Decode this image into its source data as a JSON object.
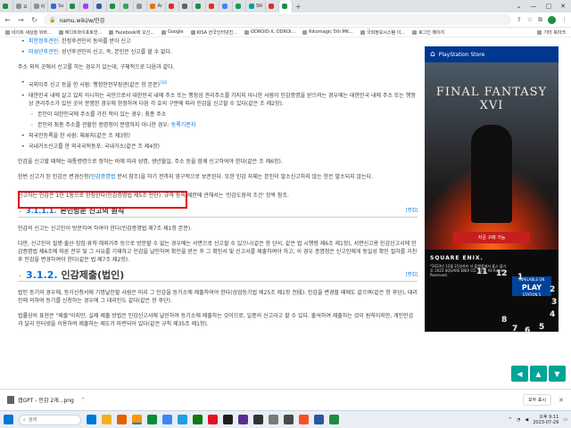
{
  "browser": {
    "tabs": [
      {
        "label": "",
        "color": "#1e8e3e"
      },
      {
        "label": "요",
        "color": "#8a8f98"
      },
      {
        "label": "하",
        "color": "#8a8f98"
      },
      {
        "label": "So",
        "color": "#3367d6"
      },
      {
        "label": "",
        "color": "#1e8e3e"
      },
      {
        "label": "",
        "color": "#a142f4"
      },
      {
        "label": "",
        "color": "#3b5998"
      },
      {
        "label": "",
        "color": "#1e8e3e"
      },
      {
        "label": "",
        "color": "#34a853"
      },
      {
        "label": "",
        "color": "#8a8f98"
      },
      {
        "label": "Ar",
        "color": "#e37400"
      },
      {
        "label": "",
        "color": "#d93025"
      },
      {
        "label": "",
        "color": "#5f6368"
      },
      {
        "label": "",
        "color": "#1e8e3e"
      },
      {
        "label": "",
        "color": "#d93025"
      },
      {
        "label": "",
        "color": "#4285f4"
      },
      {
        "label": "",
        "color": "#0f9d58"
      },
      {
        "label": "SN",
        "color": "#00a495"
      },
      {
        "label": "",
        "color": "#d93025"
      },
      {
        "label": "",
        "color": "#1e8e3e"
      }
    ],
    "window_controls": [
      "⌄",
      "—",
      "□",
      "✕"
    ],
    "url": "namu.wiki/w/인감",
    "bookmarks": [
      "네이트 세상을 뒤바...",
      "에디트와이포토한...",
      "Facebook에 오신...",
      "Google",
      "KISA 한국인터넷진...",
      "ODROID-X, ODROI...",
      "Rikomagic 5th MK...",
      "국회정보시스템 이...",
      "로그인 페이지"
    ],
    "other_bookmarks": "기타 북마크"
  },
  "article": {
    "top_items": [
      {
        "link": "피한정후견인",
        "text": ": 한정후견인의 동의를 받아 신고"
      },
      {
        "link": "미성년후견인",
        "text": ": 성년후견인의 신고, 즉, 본인은 신고를 할 수 없다."
      }
    ],
    "p_address": "주소 외의 곳에서 신고를 하는 경우가 있는데, 구체적으로 다음과 같다.",
    "list2": [
      {
        "text": "국외이주 신고 등을 한 사람: 행정안전부장관(같은 항 본문)",
        "sup": "[10]",
        "sub": false
      },
      {
        "text": "대한민국 내에 살고 있지 아니하는 국민으로서 대한민국 내에 주소 또는 행정상 관리주소를 가지지 아니한 사람이 인감증명을 받으려는 경우에는 대한민국 내에 주소 또는 행정상 관리주소가 있던 곳이 분명한 경우에 한정하여 다음 각 호의 구분에 따라 인감을 신고할 수 있다(같은 조 제2항).",
        "sup": "",
        "sub": false
      },
      {
        "text": "본인이 대한민국에 주소를 가진 적이 있는 경우: 최종 주소",
        "sub": true
      },
      {
        "text": "본인의 최종 주소를 관할한 증명청이 분명하지 아니한 경우: ",
        "link": "등록기준지",
        "sub": true
      },
      {
        "text": "외국인등록을 한 사람: 체류지(같은 조 제3항)",
        "sub": false
      },
      {
        "text": "국내거소신고를 한 외국국적동포: 국내거소(같은 조 제4항)",
        "sub": false
      }
    ],
    "p_multiple": "인감을 신고할 때에는 대통령령으로 정하는 바에 따라 성명, 생년월일, 주소 등을 함께 신고하여야 한다(같은 조 제6항).",
    "p_change_a": "한번 신고가 된 인감은 변경신청(",
    "p_change_link": "인감증명법",
    "p_change_b": " 문서 참조)을 하기 전까지 영구적으로 보존된다. 또한 인감 자체는 본인이 말소신고하지 않는 한은 말소되지 않는다.",
    "p_limit_boxed": "신고하는 인감은 1인 1통으로 한정한다(인감증명법 제5조 전단).",
    "p_limit_rest": " 규격 등의 제한에 관해서는 '인감도장의 조건' 항목 참조.",
    "sec311": {
      "num": "3.1.1.1.",
      "title": "본인방문 신고의 원칙",
      "edit": "[편집]"
    },
    "p311a": "인감의 신고는 신고인이 방문하여 하여야 한다(인감증명법 제7조 제1항 본문).",
    "p311b": "다만, 신고인이 질병·출산·징집·휴학·해외거주 등으로 방문할 수 없는 경우에는 서면으로 신고할 수 있으나(같은 항 단서, 같은 법 시행령 제6조 제1항), 서면신고용 인감신고서에 인감증명법 제6조에 따른 전부 및 그 사유를 기재하고 인감을 날인하여 확인을 받은 후 그 확인서 및 신고서를 제출하여야 하고, 이 경우 증명청은 신고인에게 동일성 확인 절차를 거친 후 인감을 변경하여야 한다(같은 법 제7조 제2항).",
    "sec312": {
      "num": "3.1.2.",
      "title": "인감제출(법인)",
      "edit": "[편집]"
    },
    "p312a": "법인 등기의 경우에, 등기신청서에 기명날인할 사람은 미리 그 인감을 등기소에 제출하여야 한다(상업등기법 제25조 제1항 전段). 인감을 변경할 때에도 같으며(같은 항 후단), 대리인에 의하여 등기를 신청하는 경우에 그 대리인도 같다(같은 항 후단).",
    "p312b": "법률상의 표현은 \"제출\"이지만, 실제 제출 방법은 인감신고서에 날인하여 등기소에 제출하는 것이므로, 일종의 신고라고 할 수 있다. 출석하여 제출하는 것이 원칙이지만, 개인인감과 달리 인터넷을 이용하여 제출하는 제도가 마련되어 있다(같은 규칙 제35조 제1항)."
  },
  "ad": {
    "store_label": "PlayStation Store",
    "game_title": "FINAL FANTASY XVI",
    "cta": "지금 구매 가능",
    "publisher": "SQUARE ENIX.",
    "fine_print": "*2023년 12월 31일까지 타 플랫폼에서 출시 불가.\n© 2023 SQUARE ENIX CO., LTD. All Rights Reserved.",
    "play_small": "AVAILABLE ON",
    "play_label": "PLAY",
    "play_sub": "STATION 5",
    "overlay_numbers": [
      "11",
      "12",
      "1",
      "2",
      "3",
      "4",
      "5",
      "6",
      "7",
      "8"
    ]
  },
  "floating": {
    "home": "◀",
    "up": "▲",
    "down": "▼"
  },
  "download_bar": {
    "file": "캡GPT - 인감 2개...png",
    "show_all": "모두 표시",
    "close": "✕"
  },
  "taskbar": {
    "search_placeholder": "검색",
    "time": "오후 9:11",
    "date": "2023-07-29",
    "apps": [
      "#0078d4",
      "#f2b01e",
      "#e66000",
      "#ff9500",
      "#0b8e36",
      "#4285f4",
      "#1ba1e2",
      "#107c10",
      "#e81123",
      "#1f1f1f",
      "#5c2d91",
      "#333333",
      "#7a7a7a",
      "#4a4a4a",
      "#f35325",
      "#2b579a",
      "#1e8e3e"
    ]
  }
}
